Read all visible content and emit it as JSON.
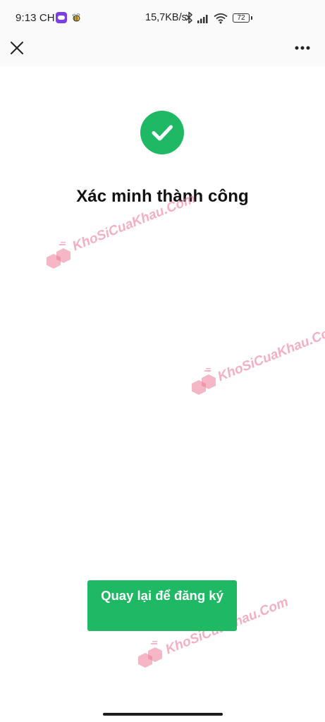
{
  "status_bar": {
    "time": "9:13 CH",
    "network_speed": "15,7KB/s",
    "battery_level": "72",
    "icons": [
      "app-notification-icon",
      "bee-icon",
      "bluetooth-icon",
      "signal-icon",
      "wifi-icon",
      "battery-icon"
    ]
  },
  "nav": {
    "close_icon": "close-icon",
    "more_icon": "more-options-icon"
  },
  "main": {
    "success_icon": "check-circle-icon",
    "title": "Xác minh thành công",
    "primary_button_label": "Quay lại để đăng ký"
  },
  "watermark": {
    "text": "KhoSiCuaKhau.Com"
  },
  "colors": {
    "accent": "#1fb864",
    "background": "#ffffff",
    "watermark": "#ec7a96"
  }
}
